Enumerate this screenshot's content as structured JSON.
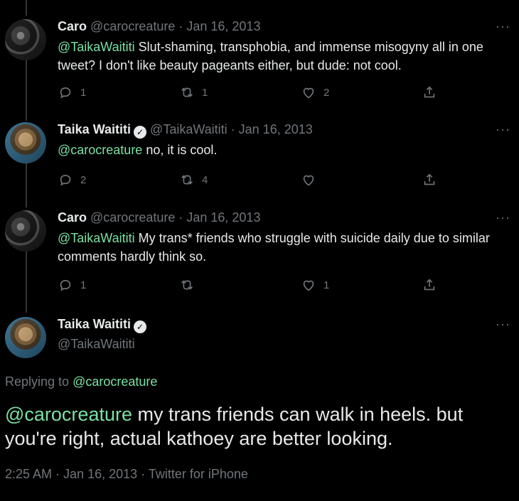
{
  "tweets": [
    {
      "name": "Caro",
      "handle": "@carocreature",
      "date": "Jan 16, 2013",
      "mention": "@TaikaWaititi",
      "text": " Slut-shaming, transphobia, and immense misogyny all in one tweet? I don't like beauty pageants either, but dude: not cool.",
      "replies": "1",
      "retweets": "1",
      "likes": "2"
    },
    {
      "name": "Taika Waititi",
      "handle": "@TaikaWaititi",
      "date": "Jan 16, 2013",
      "mention": "@carocreature",
      "text": " no, it is cool.",
      "replies": "2",
      "retweets": "4",
      "likes": ""
    },
    {
      "name": "Caro",
      "handle": "@carocreature",
      "date": "Jan 16, 2013",
      "mention": "@TaikaWaititi",
      "text": " My trans* friends who struggle with suicide daily due to similar comments hardly think so.",
      "replies": "1",
      "retweets": "",
      "likes": "1"
    }
  ],
  "main_tweet": {
    "name": "Taika Waititi",
    "handle": "@TaikaWaititi",
    "replying_prefix": "Replying to ",
    "replying_to": "@carocreature",
    "mention": "@carocreature",
    "text": " my trans friends can walk in heels. but you're right, actual kathoey are better looking.",
    "time": "2:25 AM",
    "date": "Jan 16, 2013",
    "source": "Twitter for iPhone"
  },
  "separator": " · ",
  "more_glyph": "···",
  "verified_glyph": "✓",
  "colors": {
    "background": "#000000",
    "mention": "#7be0a4",
    "muted": "#71767b"
  },
  "icons": [
    "reply-icon",
    "retweet-icon",
    "like-icon",
    "share-icon",
    "more-icon",
    "verified-badge-icon"
  ]
}
